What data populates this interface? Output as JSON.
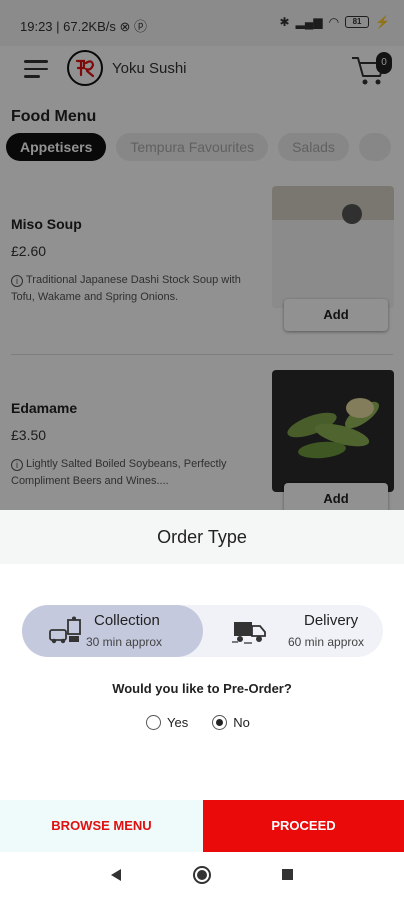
{
  "status": {
    "time_info": "19:23 | 67.2KB/s ⊗ ⓟ",
    "battery": "81"
  },
  "header": {
    "brand": "Yoku Sushi",
    "cart_count": "0"
  },
  "menu": {
    "title": "Food Menu",
    "tabs": [
      {
        "label": "Appetisers",
        "active": true
      },
      {
        "label": "Tempura Favourites",
        "active": false
      },
      {
        "label": "Salads",
        "active": false
      }
    ],
    "items": [
      {
        "name": "Miso Soup",
        "price": "£2.60",
        "description": "Traditional Japanese Dashi Stock Soup with Tofu, Wakame and Spring Onions.",
        "add_label": "Add"
      },
      {
        "name": "Edamame",
        "price": "£3.50",
        "description": "Lightly Salted Boiled Soybeans, Perfectly Compliment Beers and Wines....",
        "add_label": "Add"
      }
    ]
  },
  "sheet": {
    "title": "Order Type",
    "options": [
      {
        "label": "Collection",
        "sub": "30 min approx",
        "selected": true
      },
      {
        "label": "Delivery",
        "sub": "60 min approx",
        "selected": false
      }
    ],
    "preorder_question": "Would you like to Pre-Order?",
    "preorder": {
      "yes": "Yes",
      "no": "No",
      "selected": "No"
    }
  },
  "footer": {
    "browse": "BROWSE MENU",
    "proceed": "PROCEED"
  },
  "colors": {
    "accent": "#ea0a0a",
    "selected_option": "#c4c9dd"
  }
}
